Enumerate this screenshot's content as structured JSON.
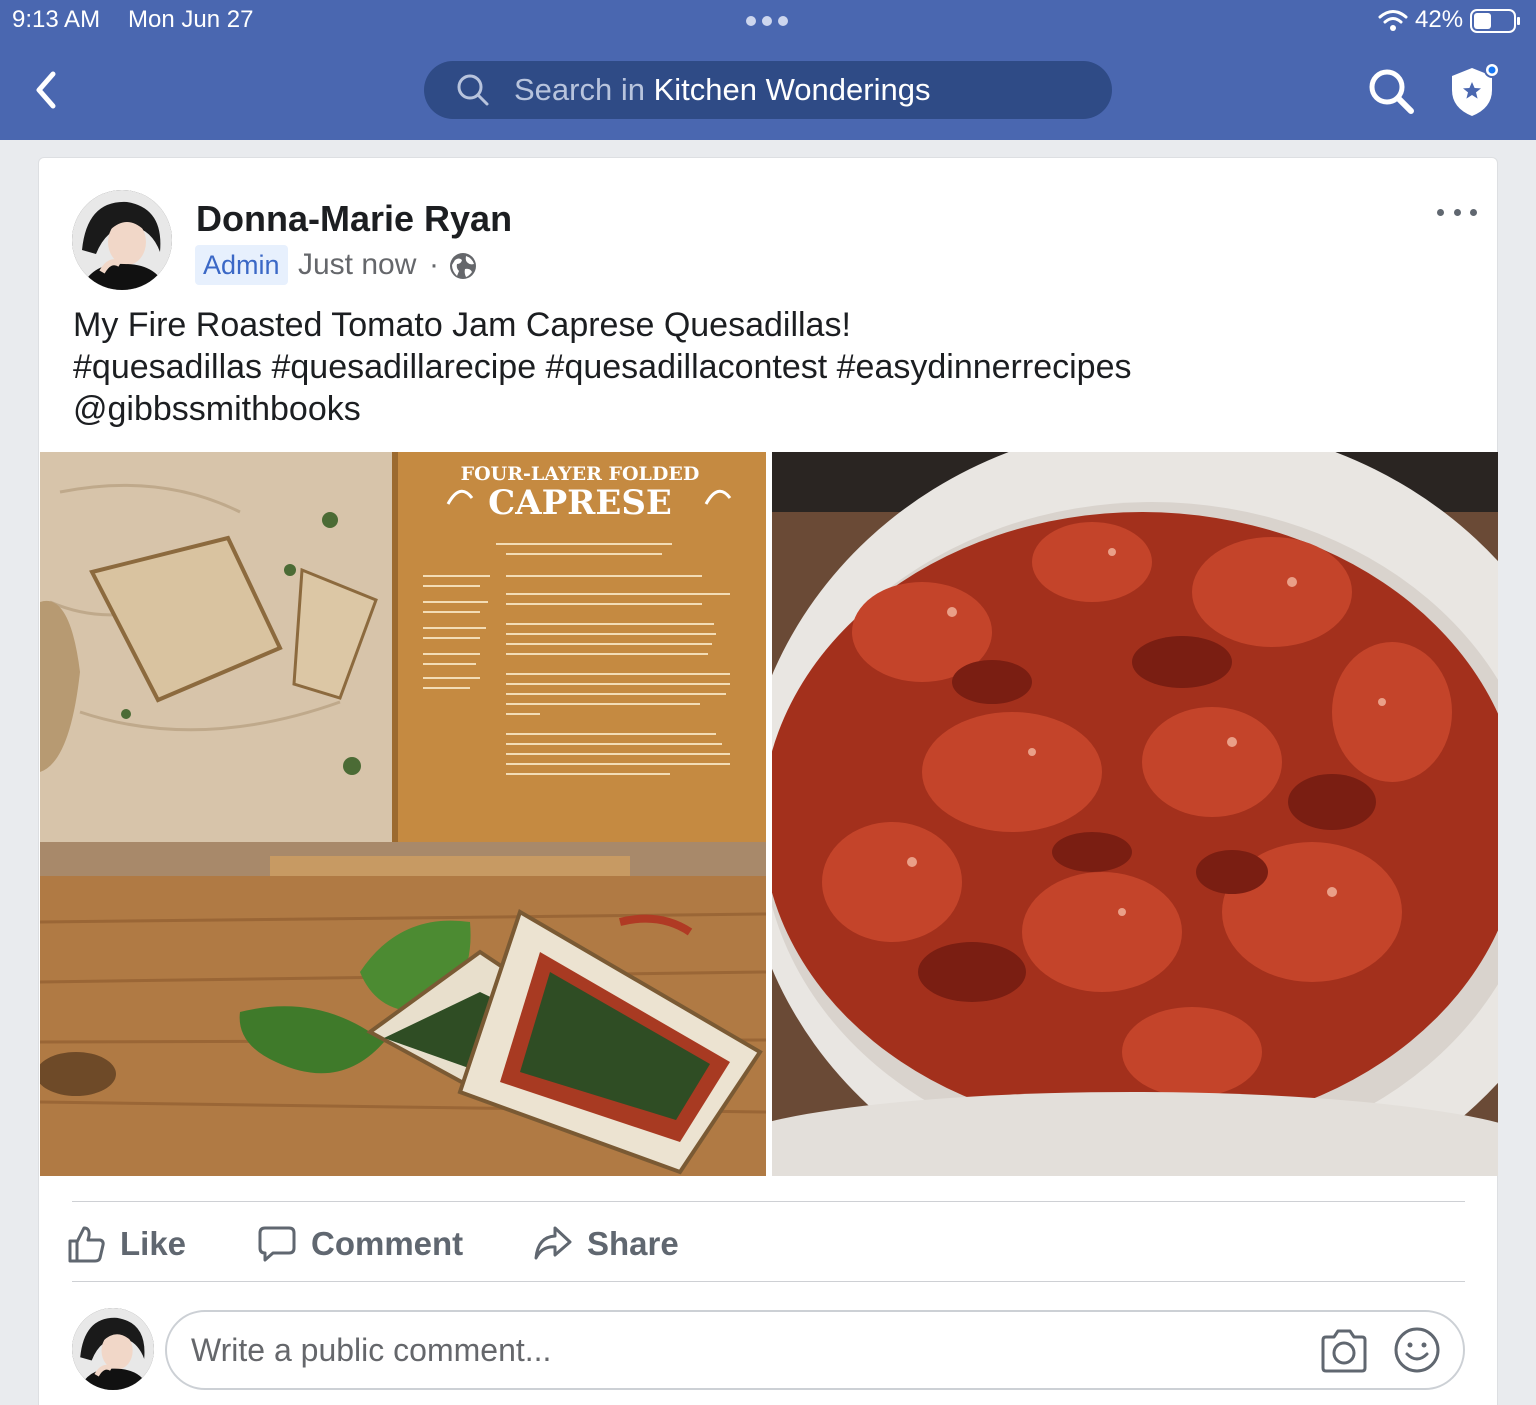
{
  "status_bar": {
    "time": "9:13 AM",
    "date": "Mon Jun 27",
    "battery_percent": "42%"
  },
  "header": {
    "search_prefix": "Search in ",
    "search_group": "Kitchen Wonderings"
  },
  "post": {
    "author": "Donna-Marie Ryan",
    "role_badge": "Admin",
    "time": "Just now",
    "separator": "·",
    "text_lines": [
      "My Fire Roasted Tomato Jam Caprese Quesadillas!",
      "#quesadillas #quesadillarecipe #quesadillacontest #easydinnerrecipes",
      "@gibbssmithbooks"
    ],
    "photos": {
      "left": {
        "book_heading": "FOUR-LAYER FOLDED",
        "book_title": "CAPRESE"
      }
    },
    "actions": {
      "like": "Like",
      "comment": "Comment",
      "share": "Share"
    },
    "comment_placeholder": "Write a public comment..."
  },
  "colors": {
    "header_blue": "#4a67b0",
    "search_bg": "#2f4b86",
    "admin_badge_bg": "#e7f0fd",
    "admin_badge_text": "#3b68c6"
  },
  "icons": [
    "back-icon",
    "search-icon",
    "admin-shield-icon",
    "globe-icon",
    "more-icon",
    "like-icon",
    "comment-icon",
    "share-icon",
    "camera-icon",
    "emoji-icon",
    "wifi-icon",
    "battery-icon"
  ]
}
